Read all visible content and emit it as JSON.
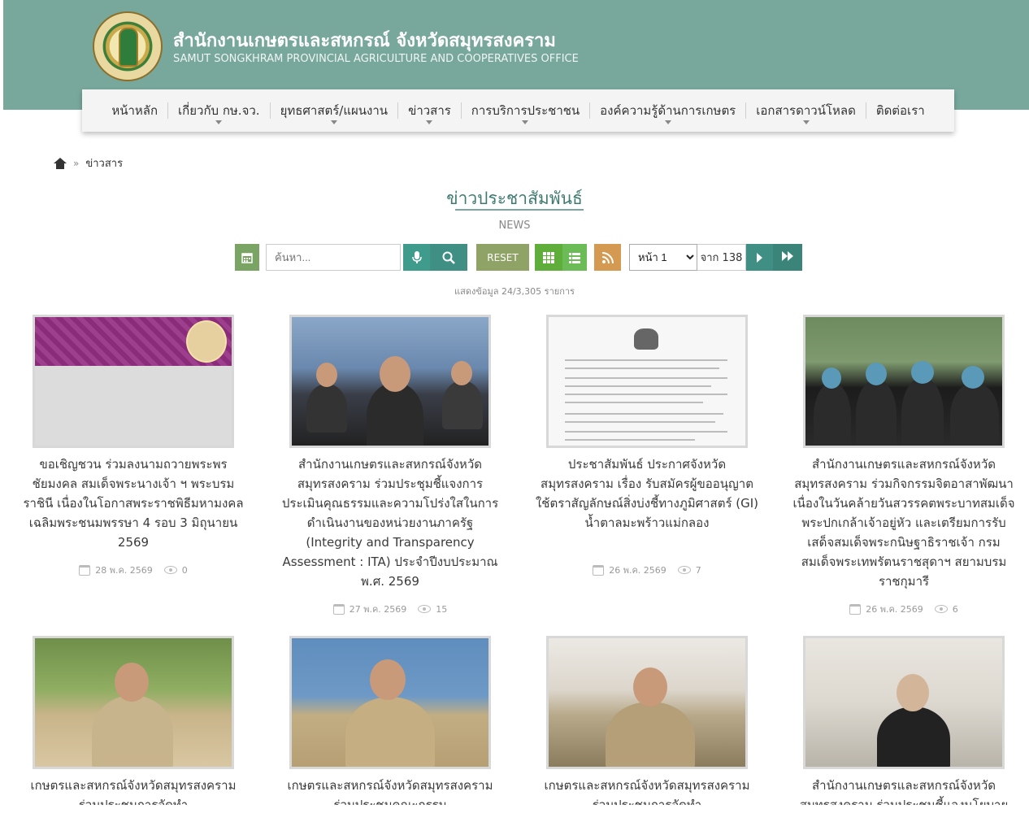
{
  "header": {
    "title": "สำนักงานเกษตรและสหกรณ์ จังหวัดสมุทรสงคราม",
    "subtitle": "SAMUT SONGKHRAM PROVINCIAL AGRICULTURE AND COOPERATIVES OFFICE"
  },
  "nav": {
    "items": [
      {
        "label": "หน้าหลัก"
      },
      {
        "label": "เกี่ยวกับ กษ.จว."
      },
      {
        "label": "ยุทธศาสตร์/แผนงาน"
      },
      {
        "label": "ข่าวสาร"
      },
      {
        "label": "การบริการประชาชน"
      },
      {
        "label": "องค์ความรู้ด้านการเกษตร"
      },
      {
        "label": "เอกสารดาวน์โหลด"
      },
      {
        "label": "ติดต่อเรา"
      }
    ]
  },
  "breadcrumb": {
    "current": "ข่าวสาร",
    "sep": "»"
  },
  "section": {
    "title": "ข่าวประชาสัมพันธ์",
    "subtitle": "NEWS"
  },
  "toolbar": {
    "search_placeholder": "ค้นหา...",
    "reset_label": "RESET",
    "page_selected": "หน้า 1",
    "of_total": "จาก 138"
  },
  "showing": "แสดงข้อมูล 24/3,305 รายการ",
  "cards": [
    {
      "title": "ขอเชิญชวน ร่วมลงนามถวายพระพรชัยมงคล สมเด็จพระนางเจ้า ฯ พระบรมราชินี เนื่องในโอกาสพระราชพิธีมหามงคลเฉลิมพระชนมพรรษา 4 รอบ 3 มิถุนายน 2569",
      "date": "28 พ.ค. 2569",
      "views": "0"
    },
    {
      "title": "สำนักงานเกษตรและสหกรณ์จังหวัดสมุทรสงคราม ร่วมประชุมชี้แจงการประเมินคุณธรรมและความโปร่งใสในการดำเนินงานของหน่วยงานภาครัฐ (Integrity and Transparency Assessment : ITA) ประจำปีงบประมาณ พ.ศ. 2569",
      "date": "27 พ.ค. 2569",
      "views": "15"
    },
    {
      "title": "ประชาสัมพันธ์ ประกาศจังหวัดสมุทรสงคราม เรื่อง รับสมัครผู้ขออนุญาตใช้ตราสัญลักษณ์สิ่งบ่งชี้ทางภูมิศาสตร์ (GI) น้ำตาลมะพร้าวแม่กลอง",
      "date": "26 พ.ค. 2569",
      "views": "7"
    },
    {
      "title": "สำนักงานเกษตรและสหกรณ์จังหวัดสมุทรสงคราม ร่วมกิจกรรมจิตอาสาพัฒนา เนื่องในวันคล้ายวันสวรรคตพระบาทสมเด็จพระปกเกล้าเจ้าอยู่หัว และเตรียมการรับเสด็จสมเด็จพระกนิษฐาธิราชเจ้า กรมสมเด็จพระเทพรัตนราชสุดาฯ สยามบรมราชกุมารี",
      "date": "26 พ.ค. 2569",
      "views": "6"
    },
    {
      "title": "เกษตรและสหกรณ์จังหวัดสมุทรสงคราม ร่วมประชุมการจัดทำ"
    },
    {
      "title": "เกษตรและสหกรณ์จังหวัดสมุทรสงคราม ร่วมประชุมคณะกรรม"
    },
    {
      "title": "เกษตรและสหกรณ์จังหวัดสมุทรสงคราม ร่วมประชุมการจัดทำ"
    },
    {
      "title": "สำนักงานเกษตรและสหกรณ์จังหวัดสมุทรสงคราม ร่วมประชุมชี้แจงนโยบาย"
    }
  ],
  "colors": {
    "header_bg": "#78a79c",
    "accent": "#3f8f84"
  },
  "icons": [
    "calendar-icon",
    "microphone-icon",
    "search-icon",
    "grid-icon",
    "list-icon",
    "rss-icon",
    "next-icon",
    "last-icon",
    "home-icon",
    "eye-icon"
  ]
}
